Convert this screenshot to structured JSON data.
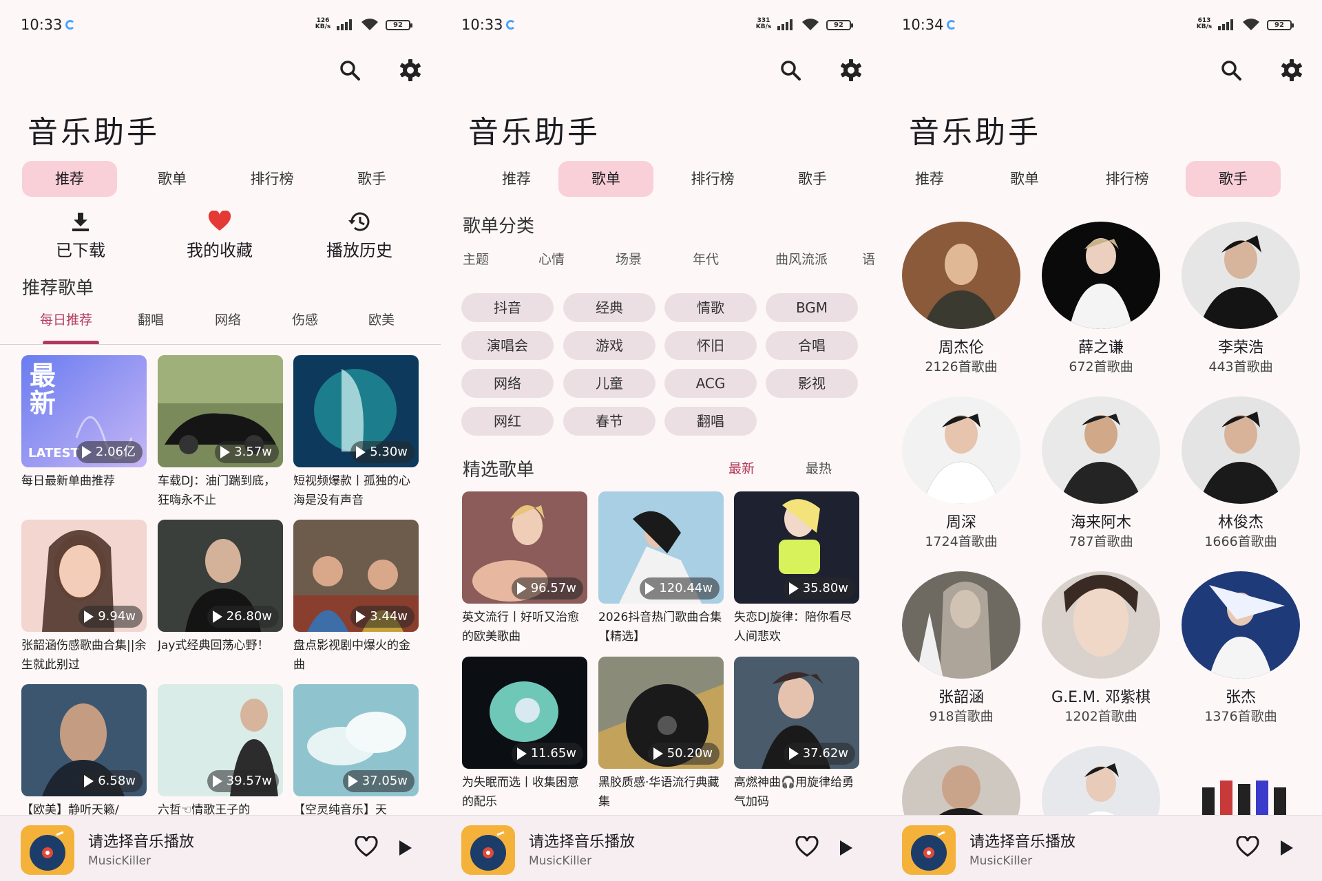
{
  "panels": [
    {
      "time": "10:33",
      "kbs": "126\nKB/s",
      "battery": "92"
    },
    {
      "time": "10:33",
      "kbs": "331\nKB/s",
      "battery": "92"
    },
    {
      "time": "10:34",
      "kbs": "613\nKB/s",
      "battery": "92"
    }
  ],
  "app_title": "音乐助手",
  "tabs": [
    "推荐",
    "歌单",
    "排行榜",
    "歌手"
  ],
  "quick_actions": [
    "已下载",
    "我的收藏",
    "播放历史"
  ],
  "recommend": {
    "section_title": "推荐歌单",
    "subtabs": [
      "每日推荐",
      "翻唱",
      "网络",
      "伤感",
      "欧美"
    ],
    "cards": [
      {
        "plays": "2.06亿",
        "caption": "每日最新单曲推荐",
        "cover_text": "最新",
        "cover_sub": "LATEST"
      },
      {
        "plays": "3.57w",
        "caption": "车载DJ：油门踹到底，狂嗨永不止"
      },
      {
        "plays": "5.30w",
        "caption": "短视频爆款丨孤独的心海是没有声音"
      },
      {
        "plays": "9.94w",
        "caption": "张韶涵伤感歌曲合集||余生就此别过"
      },
      {
        "plays": "26.80w",
        "caption": "Jay式经典回荡心野！"
      },
      {
        "plays": "3.44w",
        "caption": "盘点影视剧中爆火的金曲"
      },
      {
        "plays": "6.58w",
        "caption": "【欧美】静听天籁/"
      },
      {
        "plays": "39.57w",
        "caption": "六哲☜情歌王子的"
      },
      {
        "plays": "37.05w",
        "caption": "【空灵纯音乐】天"
      }
    ]
  },
  "playlists": {
    "category_title": "歌单分类",
    "category_tabs": [
      "主题",
      "心情",
      "场景",
      "年代",
      "曲风流派",
      "语"
    ],
    "chips": [
      "抖音",
      "经典",
      "情歌",
      "BGM",
      "演唱会",
      "游戏",
      "怀旧",
      "合唱",
      "网络",
      "儿童",
      "ACG",
      "影视",
      "网红",
      "春节",
      "翻唱"
    ],
    "featured_title": "精选歌单",
    "sort_new": "最新",
    "sort_hot": "最热",
    "cards": [
      {
        "plays": "96.57w",
        "caption": "英文流行丨好听又治愈的欧美歌曲"
      },
      {
        "plays": "120.44w",
        "caption": "2026抖音热门歌曲合集【精选】"
      },
      {
        "plays": "35.80w",
        "caption": "失恋DJ旋律：陪你看尽人间悲欢"
      },
      {
        "plays": "11.65w",
        "caption": "为失眠而选丨收集困意的配乐"
      },
      {
        "plays": "50.20w",
        "caption": "黑胶质感·华语流行典藏集"
      },
      {
        "plays": "37.62w",
        "caption": "高燃神曲🎧用旋律给勇气加码"
      }
    ]
  },
  "artists": [
    {
      "name": "周杰伦",
      "count": "2126首歌曲"
    },
    {
      "name": "薛之谦",
      "count": "672首歌曲"
    },
    {
      "name": "李荣浩",
      "count": "443首歌曲"
    },
    {
      "name": "周深",
      "count": "1724首歌曲"
    },
    {
      "name": "海来阿木",
      "count": "787首歌曲"
    },
    {
      "name": "林俊杰",
      "count": "1666首歌曲"
    },
    {
      "name": "张韶涵",
      "count": "918首歌曲"
    },
    {
      "name": "G.E.M. 邓紫棋",
      "count": "1202首歌曲"
    },
    {
      "name": "张杰",
      "count": "1376首歌曲"
    }
  ],
  "player": {
    "title": "请选择音乐播放",
    "subtitle": "MusicKiller"
  },
  "colors": {
    "accent": "#f9cfd8",
    "accent_text": "#b23a5a",
    "chip": "#ecdfe3",
    "background": "#fdf7f8"
  },
  "icons": {
    "search": "search-icon",
    "settings": "gear-icon",
    "download": "download-icon",
    "favorite": "heart-icon",
    "history": "history-icon",
    "play": "play-icon"
  }
}
